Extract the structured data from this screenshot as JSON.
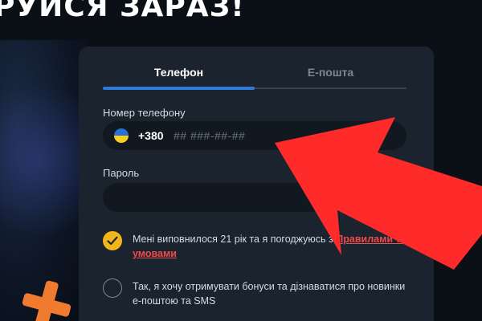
{
  "headline": "РУЙСЯ ЗАРАЗ!",
  "tabs": [
    {
      "label": "Телефон",
      "active": true
    },
    {
      "label": "Е-пошта",
      "active": false
    }
  ],
  "phone": {
    "label": "Номер телефону",
    "country_prefix": "+380",
    "placeholder": "## ###-##-##",
    "value": ""
  },
  "password": {
    "label": "Пароль",
    "value": ""
  },
  "terms": {
    "checked": true,
    "text": "Мені виповнилося 21 рік та я погоджуюсь з ",
    "link_text": "Правилами та умовами"
  },
  "bonus": {
    "checked": false,
    "text": "Так, я хочу отримувати бонуси та дізнаватися про новинки е-поштою та SMS"
  },
  "colors": {
    "accent_tab": "#2f7ad8",
    "checkbox_checked": "#f3b61a",
    "link": "#ef4b4b",
    "arrow": "#ff2a2a",
    "panel": "#1b242e"
  },
  "icons": {
    "country_flag": "ukraine-flag-icon",
    "check": "checkmark-icon",
    "overlay": "red-arrow-annotation"
  }
}
